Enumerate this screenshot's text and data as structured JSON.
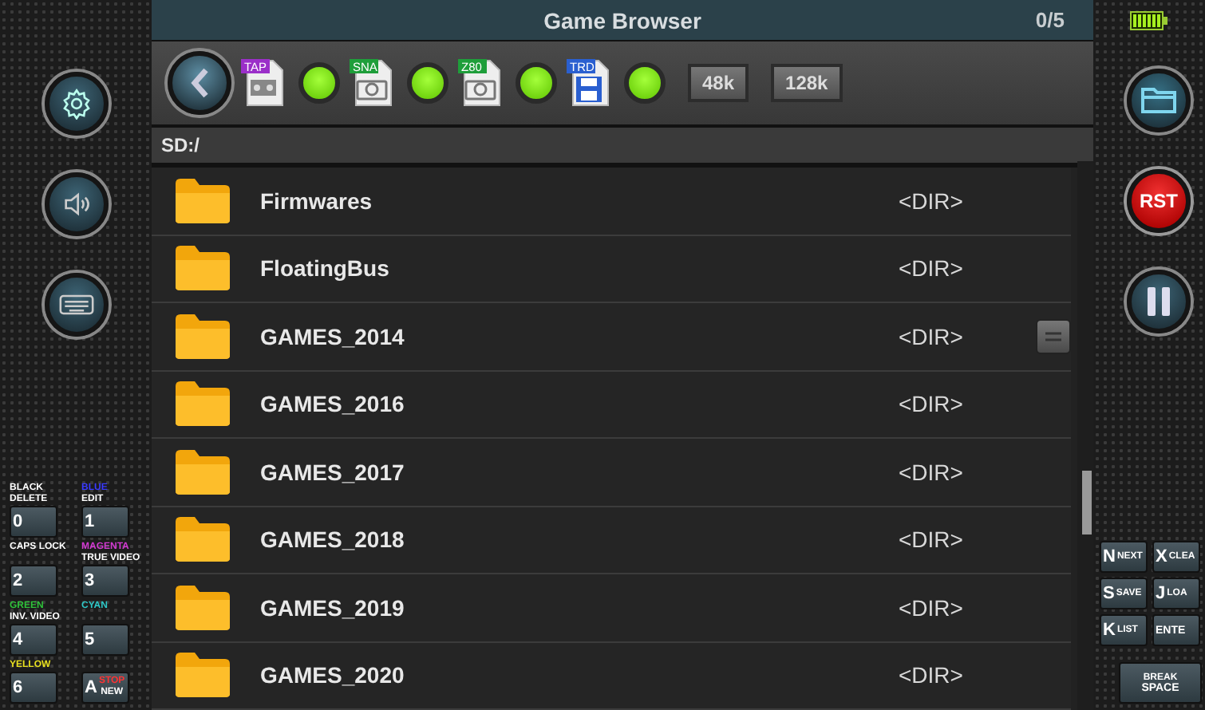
{
  "title": "Game Browser",
  "counter": "0/5",
  "formats": [
    {
      "label": "TAP",
      "color": "#9b2fc9",
      "kind": "tape",
      "on": true
    },
    {
      "label": "SNA",
      "color": "#1e9e3a",
      "kind": "camera",
      "on": true
    },
    {
      "label": "Z80",
      "color": "#1e9e3a",
      "kind": "camera",
      "on": true
    },
    {
      "label": "TRD",
      "color": "#2a5fd0",
      "kind": "disk",
      "on": true
    }
  ],
  "machines": [
    "48k",
    "128k"
  ],
  "path": "SD:/",
  "files": [
    {
      "name": "Firmwares",
      "type": "<DIR>",
      "hovered": false
    },
    {
      "name": "FloatingBus",
      "type": "<DIR>",
      "hovered": false
    },
    {
      "name": "GAMES_2014",
      "type": "<DIR>",
      "hovered": true
    },
    {
      "name": "GAMES_2016",
      "type": "<DIR>",
      "hovered": false
    },
    {
      "name": "GAMES_2017",
      "type": "<DIR>",
      "hovered": false
    },
    {
      "name": "GAMES_2018",
      "type": "<DIR>",
      "hovered": false
    },
    {
      "name": "GAMES_2019",
      "type": "<DIR>",
      "hovered": false
    },
    {
      "name": "GAMES_2020",
      "type": "<DIR>",
      "hovered": false
    }
  ],
  "left_buttons": [
    {
      "kind": "settings"
    },
    {
      "kind": "sound"
    },
    {
      "kind": "keyboard"
    }
  ],
  "right_buttons": [
    {
      "kind": "folder"
    },
    {
      "kind": "reset",
      "label": "RST"
    },
    {
      "kind": "pause"
    }
  ],
  "left_keys": [
    {
      "main": "0",
      "above": [
        {
          "text": "BLACK",
          "color": "#ffffff"
        },
        {
          "text": "DELETE",
          "color": "#ffffff"
        }
      ]
    },
    {
      "main": "1",
      "above": [
        {
          "text": "BLUE",
          "color": "#3a3aff"
        },
        {
          "text": "EDIT",
          "color": "#ffffff"
        }
      ]
    },
    {
      "main": "2",
      "above": [
        {
          "text": "CAPS LOCK",
          "color": "#ffffff"
        }
      ]
    },
    {
      "main": "3",
      "above": [
        {
          "text": "MAGENTA",
          "color": "#d23ad2"
        },
        {
          "text": "TRUE VIDEO",
          "color": "#ffffff"
        }
      ]
    },
    {
      "main": "4",
      "above": [
        {
          "text": "GREEN",
          "color": "#2fc23a"
        },
        {
          "text": "INV. VIDEO",
          "color": "#ffffff"
        }
      ]
    },
    {
      "main": "5",
      "above": [
        {
          "text": "CYAN",
          "color": "#2fc8c8"
        }
      ]
    },
    {
      "main": "6",
      "above": [
        {
          "text": "YELLOW",
          "color": "#e8e020"
        }
      ]
    },
    {
      "main": "A",
      "side": "STOP",
      "sub": "NEW"
    }
  ],
  "right_keys": [
    {
      "main": "N",
      "sub": "NEXT"
    },
    {
      "main": "X",
      "sub": "CLEA"
    },
    {
      "main": "S",
      "sub": "SAVE"
    },
    {
      "main": "J",
      "sub": "LOA"
    },
    {
      "main": "K",
      "sub": "LIST"
    },
    {
      "main": "ENTE"
    }
  ],
  "space_key": {
    "top": "BREAK",
    "main": "SPACE"
  }
}
